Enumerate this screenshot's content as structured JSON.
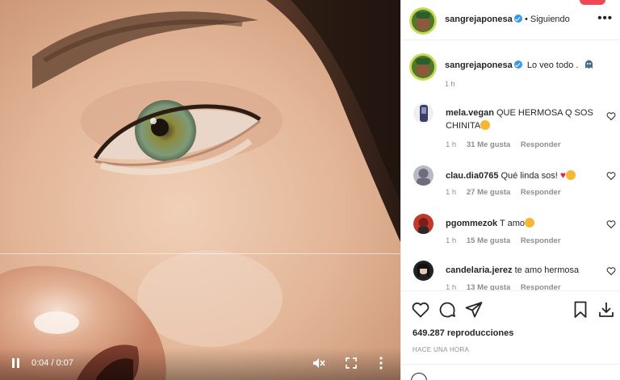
{
  "video": {
    "time_display": "0:04 / 0:07",
    "progress_fraction": 0.57,
    "muted": true
  },
  "header": {
    "username": "sangrejaponesa",
    "dot": "•",
    "follow_label": "Siguiendo",
    "more_label": "•••"
  },
  "caption": {
    "username": "sangrejaponesa",
    "text": "Lo veo todo .",
    "time": "1 h"
  },
  "comments": [
    {
      "username": "mela.vegan",
      "text": "QUE HERMOSA Q SOS CHINITA",
      "emoji": "heart-eyes-emoji",
      "time": "1 h",
      "likes": "31 Me gusta",
      "reply": "Responder"
    },
    {
      "username": "clau.dia0765",
      "text": "Qué linda sos!",
      "emoji": "heart-eyes-emoji",
      "time": "1 h",
      "likes": "27 Me gusta",
      "reply": "Responder"
    },
    {
      "username": "pgommezok",
      "text": "T amo",
      "emoji": "heart-eyes-emoji",
      "time": "1 h",
      "likes": "15 Me gusta",
      "reply": "Responder"
    },
    {
      "username": "candelaria.jerez",
      "text": "te amo hermosa",
      "time": "1 h",
      "likes": "13 Me gusta",
      "reply": "Responder"
    }
  ],
  "stats": {
    "views": "649.287 reproducciones",
    "posted": "HACE UNA HORA"
  },
  "icons": [
    "pause-icon",
    "mute-icon",
    "fullscreen-icon",
    "heart-icon",
    "comment-icon",
    "share-icon",
    "bookmark-icon",
    "download-icon",
    "more-icon",
    "verified-icon"
  ],
  "colors": {
    "accent": "#3897f0",
    "notification": "#ed4956",
    "muted_text": "#8e8e8e"
  }
}
